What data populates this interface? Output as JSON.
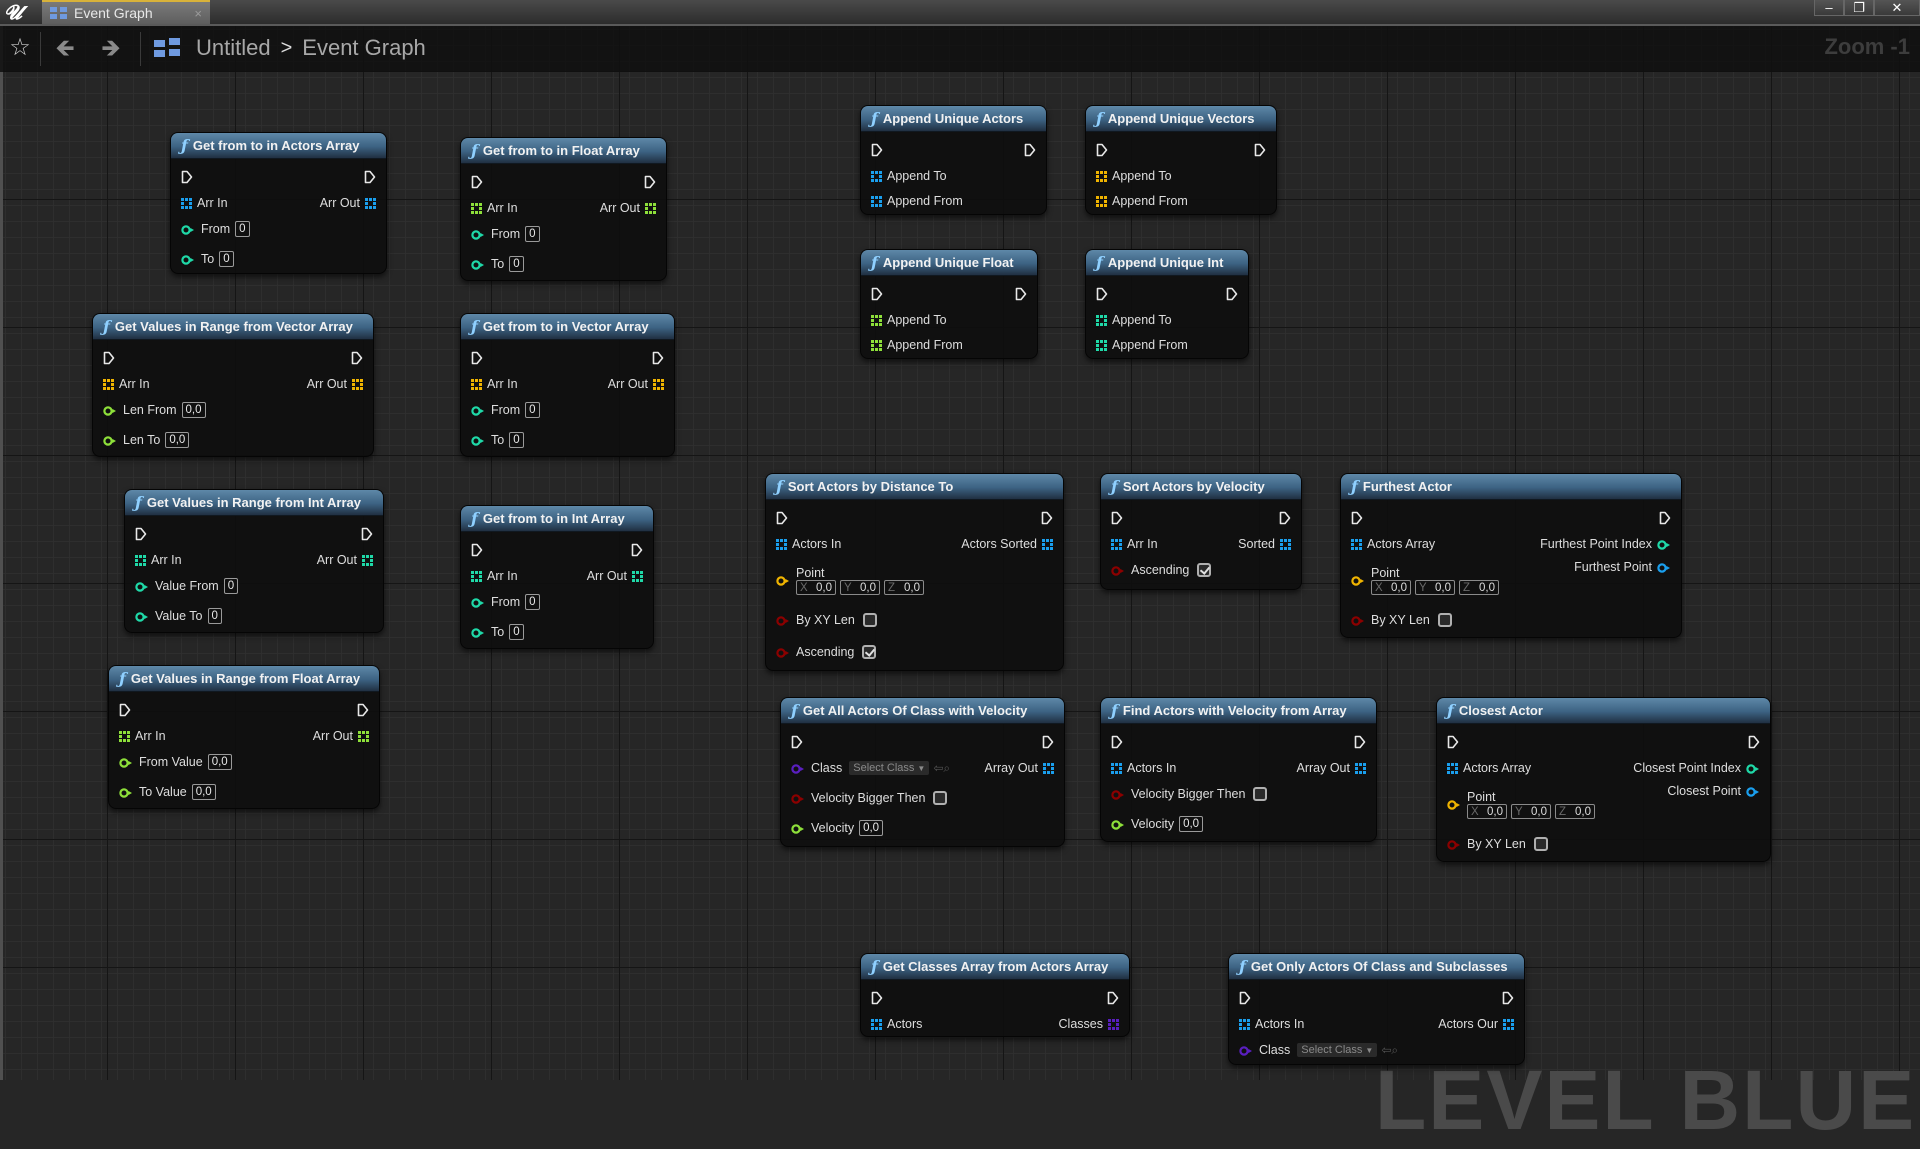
{
  "window": {
    "app_logo": "UE",
    "tab_label": "Event Graph",
    "tab_close": "×",
    "controls": {
      "minimize": "–",
      "restore": "❐",
      "close": "✕"
    }
  },
  "toolbar": {
    "breadcrumb": [
      "Untitled",
      "Event Graph"
    ],
    "breadcrumb_separator": ">",
    "zoom_label": "Zoom -1",
    "icons": [
      "star-icon",
      "back-arrow-icon",
      "forward-arrow-icon",
      "graph-icon"
    ]
  },
  "watermark": "LEVEL BLUEPRINT",
  "pin_colors": {
    "actor": "#1a9fee",
    "vector": "#f0b400",
    "float": "#8ee03a",
    "int": "#1fd9a8",
    "bool": "#8c0000",
    "class": "#5a1fc0",
    "vec_out": "#1a9fee",
    "exec": "#e8e8e8"
  },
  "nodes": [
    {
      "id": "get-from-to-actors",
      "title": "Get from to in Actors Array",
      "arr_type": "actor",
      "in": "Arr In",
      "out": "Arr Out",
      "params": [
        {
          "label": "From",
          "type": "int",
          "value": "0"
        },
        {
          "label": "To",
          "type": "int",
          "value": "0"
        }
      ]
    },
    {
      "id": "get-from-to-float",
      "title": "Get from to in Float Array",
      "arr_type": "float",
      "in": "Arr In",
      "out": "Arr Out",
      "params": [
        {
          "label": "From",
          "type": "int",
          "value": "0"
        },
        {
          "label": "To",
          "type": "int",
          "value": "0"
        }
      ]
    },
    {
      "id": "range-vector",
      "title": "Get Values in Range from Vector Array",
      "arr_type": "vector",
      "in": "Arr In",
      "out": "Arr Out",
      "params": [
        {
          "label": "Len From",
          "type": "float",
          "value": "0,0"
        },
        {
          "label": "Len To",
          "type": "float",
          "value": "0,0"
        }
      ]
    },
    {
      "id": "get-from-to-vector",
      "title": "Get from to in Vector Array",
      "arr_type": "vector",
      "in": "Arr In",
      "out": "Arr Out",
      "params": [
        {
          "label": "From",
          "type": "int",
          "value": "0"
        },
        {
          "label": "To",
          "type": "int",
          "value": "0"
        }
      ]
    },
    {
      "id": "range-int",
      "title": "Get Values in Range from Int Array",
      "arr_type": "int",
      "in": "Arr In",
      "out": "Arr Out",
      "params": [
        {
          "label": "Value From",
          "type": "int",
          "value": "0"
        },
        {
          "label": "Value To",
          "type": "int",
          "value": "0"
        }
      ]
    },
    {
      "id": "get-from-to-int",
      "title": "Get from to in Int Array",
      "arr_type": "int",
      "in": "Arr In",
      "out": "Arr Out",
      "params": [
        {
          "label": "From",
          "type": "int",
          "value": "0"
        },
        {
          "label": "To",
          "type": "int",
          "value": "0"
        }
      ]
    },
    {
      "id": "range-float",
      "title": "Get Values in Range from Float Array",
      "arr_type": "float",
      "in": "Arr In",
      "out": "Arr Out",
      "params": [
        {
          "label": "From Value",
          "type": "float",
          "value": "0,0"
        },
        {
          "label": "To Value",
          "type": "float",
          "value": "0,0"
        }
      ]
    },
    {
      "id": "append-actors",
      "title": "Append Unique Actors",
      "arr_type": "actor",
      "append": [
        "Append To",
        "Append From"
      ]
    },
    {
      "id": "append-vectors",
      "title": "Append Unique Vectors",
      "arr_type": "vector",
      "append": [
        "Append To",
        "Append From"
      ]
    },
    {
      "id": "append-float",
      "title": "Append Unique Float",
      "arr_type": "float",
      "append": [
        "Append To",
        "Append From"
      ]
    },
    {
      "id": "append-int",
      "title": "Append Unique Int",
      "arr_type": "int",
      "append": [
        "Append To",
        "Append From"
      ]
    },
    {
      "id": "sort-distance",
      "title": "Sort Actors by Distance To",
      "in": "Actors In",
      "out": "Actors Sorted",
      "point_label": "Point",
      "point": {
        "x": "0,0",
        "y": "0,0",
        "z": "0,0"
      },
      "bools": [
        {
          "label": "By XY Len",
          "checked": false
        },
        {
          "label": "Ascending",
          "checked": true
        }
      ]
    },
    {
      "id": "sort-velocity",
      "title": "Sort Actors by Velocity",
      "in": "Arr In",
      "out": "Sorted",
      "bools": [
        {
          "label": "Ascending",
          "checked": true
        }
      ]
    },
    {
      "id": "furthest-actor",
      "title": "Furthest Actor",
      "in": "Actors Array",
      "out_index": "Furthest Point Index",
      "out_point": "Furthest Point",
      "point_label": "Point",
      "point": {
        "x": "0,0",
        "y": "0,0",
        "z": "0,0"
      },
      "bools": [
        {
          "label": "By XY Len",
          "checked": false
        }
      ]
    },
    {
      "id": "get-all-velocity",
      "title": "Get All Actors Of Class with Velocity",
      "class_label": "Class",
      "class_placeholder": "Select Class",
      "out": "Array Out",
      "bools": [
        {
          "label": "Velocity Bigger Then",
          "checked": false
        }
      ],
      "velocity_label": "Velocity",
      "velocity": "0,0"
    },
    {
      "id": "find-velocity",
      "title": "Find Actors with Velocity from Array",
      "in": "Actors In",
      "out": "Array Out",
      "bools": [
        {
          "label": "Velocity Bigger Then",
          "checked": false
        }
      ],
      "velocity_label": "Velocity",
      "velocity": "0,0"
    },
    {
      "id": "closest-actor",
      "title": "Closest Actor",
      "in": "Actors Array",
      "out_index": "Closest Point Index",
      "out_point": "Closest Point",
      "point_label": "Point",
      "point": {
        "x": "0,0",
        "y": "0,0",
        "z": "0,0"
      },
      "bools": [
        {
          "label": "By XY Len",
          "checked": false
        }
      ]
    },
    {
      "id": "get-classes",
      "title": "Get Classes Array from Actors Array",
      "in": "Actors",
      "out": "Classes"
    },
    {
      "id": "get-only-class",
      "title": "Get Only Actors Of Class and Subclasses",
      "in": "Actors In",
      "out": "Actors Our",
      "class_label": "Class",
      "class_placeholder": "Select Class"
    }
  ]
}
